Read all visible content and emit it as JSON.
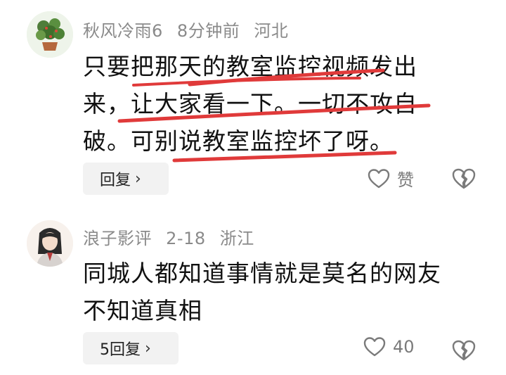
{
  "comments": [
    {
      "username": "秋风冷雨6",
      "time": "8分钟前",
      "location": "河北",
      "text": "只要把那天的教室监控视频发出来，让大家看一下。一切不攻自破。可别说教室监控坏了呀。",
      "reply_label": "回复",
      "like_label": "赞"
    },
    {
      "username": "浪子影评",
      "time": "2-18",
      "location": "浙江",
      "text": "同城人都知道事情就是莫名的网友不知道真相",
      "reply_label": "5回复",
      "like_count": "40"
    }
  ],
  "icons": {
    "reply_chevron": "chevron-right-icon",
    "like": "heart-outline-icon",
    "dislike": "broken-heart-icon"
  },
  "colors": {
    "annotation_underline": "#e03a3a",
    "meta_text": "#8a8a8a",
    "body_text": "#111111",
    "reply_bg": "#f2f2f2"
  }
}
